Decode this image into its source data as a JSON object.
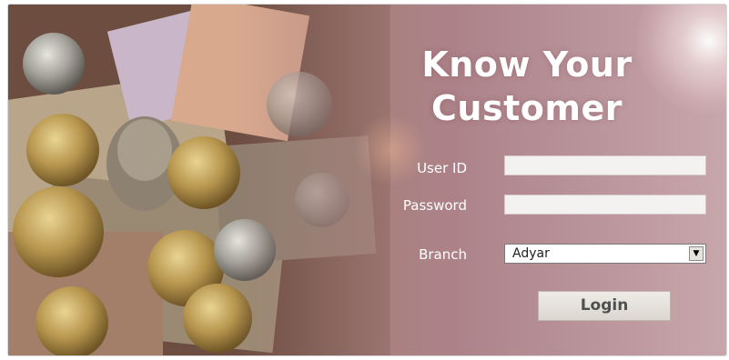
{
  "header": {
    "title_line1": "Know Your",
    "title_line2": "Customer"
  },
  "form": {
    "user_id_label": "User ID",
    "user_id_value": "",
    "password_label": "Password",
    "password_value": "",
    "branch_label": "Branch",
    "branch_selected": "Adyar",
    "login_label": "Login"
  },
  "icons": {
    "dropdown": "chevron-down-icon"
  },
  "colors": {
    "background_accent": "#ac8288",
    "title_text": "#ffffff",
    "button_text": "#505050"
  }
}
